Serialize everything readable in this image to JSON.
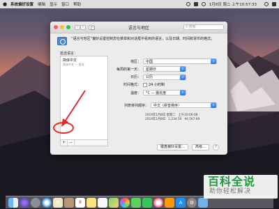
{
  "menubar": {
    "items": [
      "系统偏好设置",
      "编辑",
      "显示",
      "窗口",
      "帮助"
    ],
    "clock": "1月8日 周二 上午10:57:33"
  },
  "window": {
    "title": "语言与地区",
    "search_placeholder": "搜索",
    "intro": "“语言与地区”偏好设置控制您在菜单和对话框中看到的语言，以及日期、时间和货币的格式。",
    "preferred_languages_label": "首选语言：",
    "languages": [
      {
        "name": "简体中文",
        "sub": "简体中文 — 首选"
      }
    ],
    "list_buttons": [
      "+",
      "−"
    ],
    "fields": [
      {
        "label": "地区：",
        "value": "中国"
      },
      {
        "label": "每周的第一天：",
        "value": "星期日"
      },
      {
        "label": "日历：",
        "value": "公历"
      },
      {
        "label": "时间格式：",
        "value": "24 小时制"
      },
      {
        "label": "温度：",
        "value": "°C — 摄氏度"
      }
    ],
    "sort_label": "列表排列顺序：",
    "sort_value": "中文（拼音排序）",
    "sample_lines": [
      [
        "2019年1月8日 星期二",
        "上午10:09:08"
      ],
      [
        "2019年1月8日",
        "1,234.56",
        "¥4,567.89"
      ]
    ],
    "buttons": {
      "keyboard": "键盘偏好设置…",
      "advanced": "高级…",
      "help": "?"
    }
  },
  "watermark": {
    "title": "百科全说",
    "subtitle": "助你轻松解决"
  },
  "dock_icons": [
    "finder-icon",
    "siri-icon",
    "launchpad-icon",
    "safari-icon",
    "mail-icon",
    "contacts-icon",
    "calendar-icon",
    "notes-icon",
    "reminders-icon",
    "maps-icon",
    "photos-icon",
    "messages-icon",
    "facetime-icon",
    "itunes-icon",
    "ibooks-icon",
    "app-store-icon",
    "system-preferences-icon",
    "folder-icon"
  ]
}
